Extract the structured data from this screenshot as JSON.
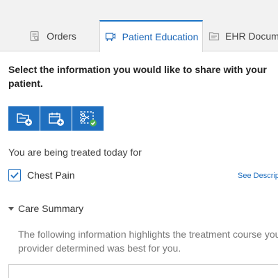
{
  "tabs": [
    {
      "label": "Orders",
      "icon": "orders-icon",
      "active": false
    },
    {
      "label": "Patient Education",
      "icon": "presentation-icon",
      "active": true
    },
    {
      "label": "EHR Documen",
      "icon": "document-icon",
      "active": false
    }
  ],
  "prompt": "Select the information you would like to share with your patient.",
  "action_buttons": [
    {
      "icon": "add-folder-icon"
    },
    {
      "icon": "add-calendar-icon"
    },
    {
      "icon": "scissors-check-icon"
    }
  ],
  "treated_text": "You are being treated today for",
  "condition": {
    "label": "Chest Pain",
    "checked": true
  },
  "see_description": "See Descrip",
  "care_summary": {
    "label": "Care Summary",
    "text_line1": "The following information highlights the treatment course you",
    "text_line2": "provider determined was best for you."
  },
  "colors": {
    "accent": "#1f6fbf",
    "active_tab_text": "#1a66b8",
    "tab_bg": "#f2f2f2",
    "check": "#4caf50"
  }
}
